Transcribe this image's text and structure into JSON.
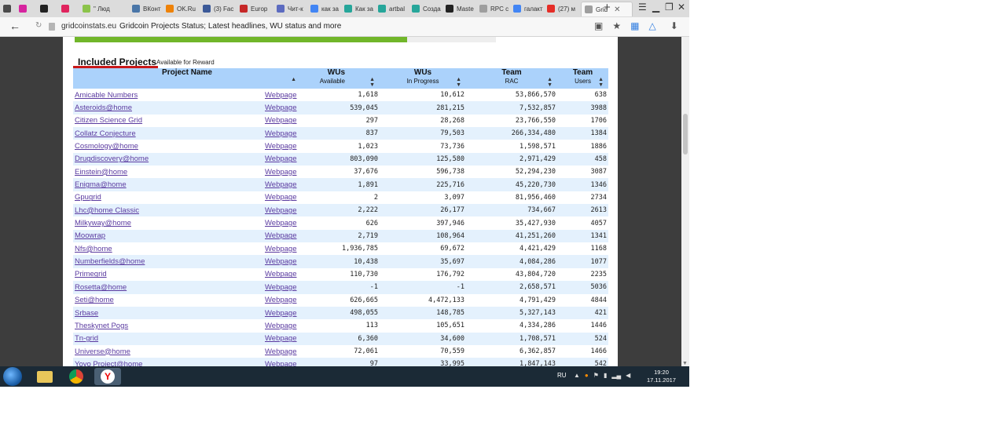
{
  "browser": {
    "tabs": [
      {
        "label": "",
        "color": "#4a4a4a"
      },
      {
        "label": "",
        "color": "#d6249f"
      },
      {
        "label": "",
        "color": "#222222"
      },
      {
        "label": "",
        "color": "#e0245e"
      },
      {
        "label": "\" Люд",
        "color": "#8bc34a"
      },
      {
        "label": "ВКонт",
        "color": "#4a76a8"
      },
      {
        "label": "OK.Ru",
        "color": "#ee8208"
      },
      {
        "label": "(3) Fac",
        "color": "#3b5998"
      },
      {
        "label": "Europ",
        "color": "#c62828"
      },
      {
        "label": "Чит-к",
        "color": "#5c6bc0"
      },
      {
        "label": "как за",
        "color": "#4285f4"
      },
      {
        "label": "Как за",
        "color": "#26a69a"
      },
      {
        "label": "artbal",
        "color": "#26a69a"
      },
      {
        "label": "Созда",
        "color": "#26a69a"
      },
      {
        "label": "Maste",
        "color": "#222222"
      },
      {
        "label": "RPC c",
        "color": "#9e9e9e"
      },
      {
        "label": "галакт",
        "color": "#4285f4"
      },
      {
        "label": "(27) м",
        "color": "#e52d27"
      },
      {
        "label": "Grid",
        "color": "#9e9e9e"
      }
    ],
    "new_tab": "+",
    "address": {
      "domain": "gridcoinstats.eu",
      "title": "Gridcoin Projects Status; Latest headlines, WU status and more"
    }
  },
  "section": {
    "title": "Included Projects",
    "subtitle": "Available for Reward"
  },
  "table": {
    "headers": [
      {
        "label": "Project Name",
        "sub": ""
      },
      {
        "label": "",
        "sub": ""
      },
      {
        "label": "WUs",
        "sub": "Available"
      },
      {
        "label": "WUs",
        "sub": "In Progress"
      },
      {
        "label": "Team",
        "sub": "RAC"
      },
      {
        "label": "Team",
        "sub": "Users"
      }
    ],
    "link_label": "Webpage",
    "rows": [
      {
        "name": "Amicable Numbers",
        "avail": "1,618",
        "prog": "10,612",
        "rac": "53,866,570",
        "users": "638"
      },
      {
        "name": "Asteroids@home",
        "avail": "539,045",
        "prog": "281,215",
        "rac": "7,532,857",
        "users": "3988"
      },
      {
        "name": "Citizen Science Grid",
        "avail": "297",
        "prog": "28,268",
        "rac": "23,766,550",
        "users": "1706"
      },
      {
        "name": "Collatz Conjecture",
        "avail": "837",
        "prog": "79,503",
        "rac": "266,334,480",
        "users": "1384"
      },
      {
        "name": "Cosmology@home",
        "avail": "1,023",
        "prog": "73,736",
        "rac": "1,598,571",
        "users": "1886"
      },
      {
        "name": "Drugdiscovery@home",
        "avail": "803,090",
        "prog": "125,580",
        "rac": "2,971,429",
        "users": "458"
      },
      {
        "name": "Einstein@home",
        "avail": "37,676",
        "prog": "596,738",
        "rac": "52,294,230",
        "users": "3087"
      },
      {
        "name": "Enigma@home",
        "avail": "1,891",
        "prog": "225,716",
        "rac": "45,220,730",
        "users": "1346"
      },
      {
        "name": "Gpugrid",
        "avail": "2",
        "prog": "3,097",
        "rac": "81,956,460",
        "users": "2734"
      },
      {
        "name": "Lhc@home Classic",
        "avail": "2,222",
        "prog": "26,177",
        "rac": "734,667",
        "users": "2613"
      },
      {
        "name": "Milkyway@home",
        "avail": "626",
        "prog": "397,946",
        "rac": "35,427,930",
        "users": "4057"
      },
      {
        "name": "Moowrap",
        "avail": "2,719",
        "prog": "108,964",
        "rac": "41,251,260",
        "users": "1341"
      },
      {
        "name": "Nfs@home",
        "avail": "1,936,785",
        "prog": "69,672",
        "rac": "4,421,429",
        "users": "1168"
      },
      {
        "name": "Numberfields@home",
        "avail": "10,438",
        "prog": "35,697",
        "rac": "4,084,286",
        "users": "1077"
      },
      {
        "name": "Primegrid",
        "avail": "110,730",
        "prog": "176,792",
        "rac": "43,804,720",
        "users": "2235"
      },
      {
        "name": "Rosetta@home",
        "avail": "-1",
        "prog": "-1",
        "rac": "2,658,571",
        "users": "5036"
      },
      {
        "name": "Seti@home",
        "avail": "626,665",
        "prog": "4,472,133",
        "rac": "4,791,429",
        "users": "4844"
      },
      {
        "name": "Srbase",
        "avail": "498,055",
        "prog": "148,785",
        "rac": "5,327,143",
        "users": "421"
      },
      {
        "name": "Theskynet Pogs",
        "avail": "113",
        "prog": "105,651",
        "rac": "4,334,286",
        "users": "1446"
      },
      {
        "name": "Tn-grid",
        "avail": "6,360",
        "prog": "34,600",
        "rac": "1,708,571",
        "users": "524"
      },
      {
        "name": "Universe@home",
        "avail": "72,061",
        "prog": "70,559",
        "rac": "6,362,857",
        "users": "1466"
      },
      {
        "name": "Yoyo Project@home",
        "avail": "97",
        "prog": "33,995",
        "rac": "1,847,143",
        "users": "542"
      }
    ]
  },
  "taskbar": {
    "language": "RU",
    "time": "19:20",
    "date": "17.11.2017"
  }
}
